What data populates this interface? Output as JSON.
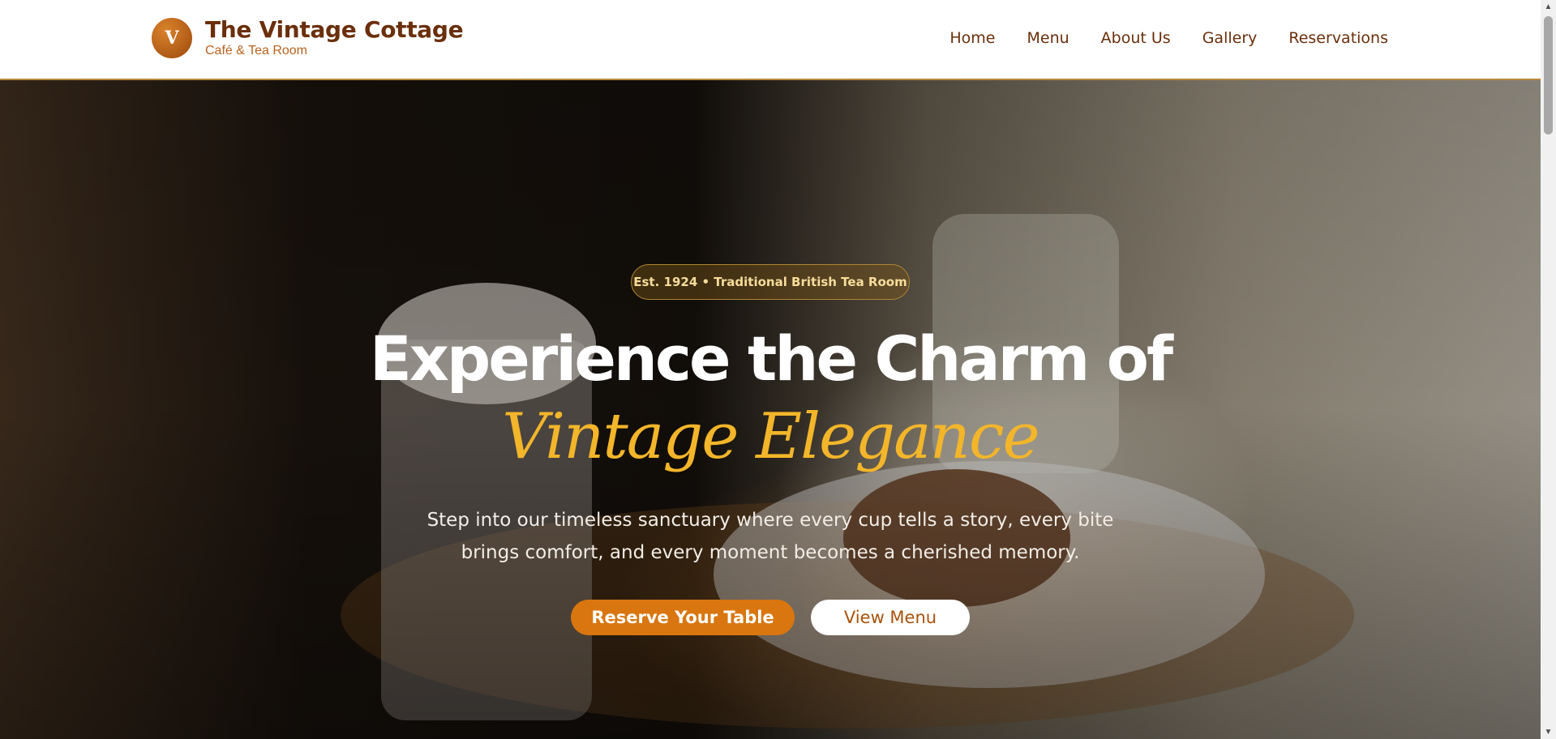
{
  "header": {
    "logo_letter": "V",
    "brand_name": "The Vintage Cottage",
    "brand_tagline": "Café & Tea Room",
    "nav": [
      {
        "label": "Home"
      },
      {
        "label": "Menu"
      },
      {
        "label": "About Us"
      },
      {
        "label": "Gallery"
      },
      {
        "label": "Reservations"
      }
    ]
  },
  "hero": {
    "badge": "Est. 1924 • Traditional British Tea Room",
    "headline": "Experience the Charm of",
    "headline_accent": "Vintage Elegance",
    "subtext": "Step into our timeless sanctuary where every cup tells a story, every bite brings comfort, and every moment becomes a cherished memory.",
    "primary_button": "Reserve Your Table",
    "secondary_button": "View Menu"
  },
  "colors": {
    "brand_brown": "#6a2f0b",
    "accent_gold": "#f3b52a",
    "button_orange": "#d9760f"
  },
  "icons": {
    "scroll_up": "chevron-up-icon",
    "scroll_down": "chevron-down-icon"
  }
}
